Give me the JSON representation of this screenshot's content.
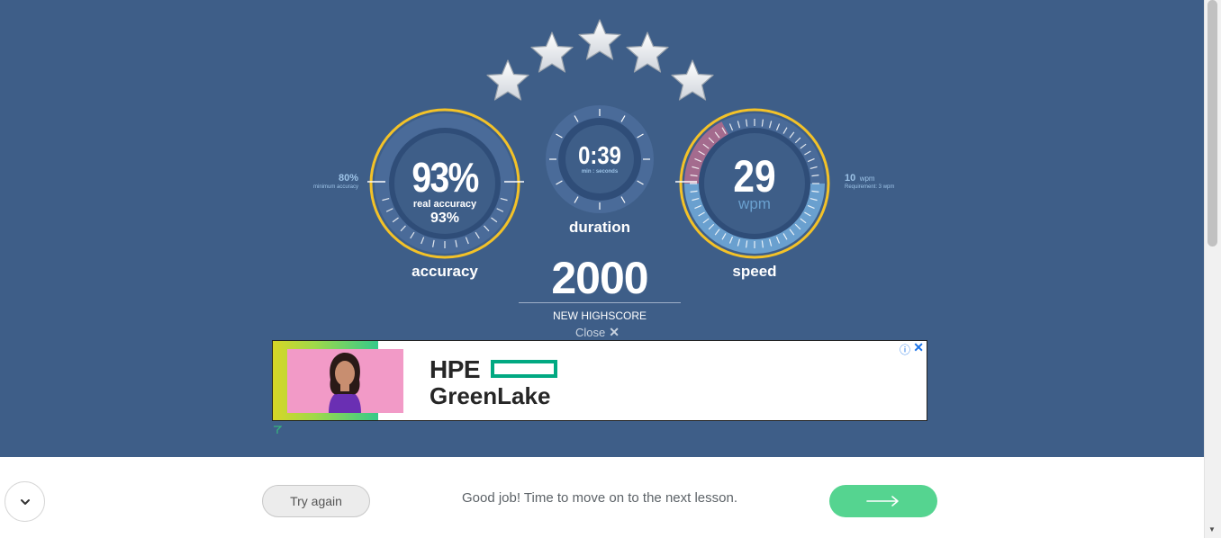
{
  "stars": {
    "count": 5,
    "filled": 5,
    "color": "#ffffff"
  },
  "accuracy": {
    "value": "93%",
    "real_label": "real accuracy",
    "real_value": "93%",
    "caption": "accuracy",
    "minimum_value": "80%",
    "minimum_label": "minimum accuracy",
    "level": 0.93
  },
  "duration": {
    "value": "0:39",
    "unit_label": "min : seconds",
    "caption": "duration"
  },
  "speed": {
    "value": "29",
    "unit": "wpm",
    "caption": "speed",
    "requirement_value": "10",
    "requirement_unit": "wpm",
    "requirement_label": "Requirement: 3 wpm"
  },
  "score": {
    "value": "2000",
    "caption": "NEW HIGHSCORE"
  },
  "close": {
    "label": "Close",
    "icon": "close-icon"
  },
  "ad": {
    "brand_line1": "HPE",
    "brand_line2": "GreenLake",
    "info_icon": "info-icon",
    "close_icon": "close-icon"
  },
  "footer": {
    "try_again": "Try again",
    "message": "Good job! Time to move on to the next lesson.",
    "next_icon": "arrow-right-icon",
    "toggle_icon": "chevron-down-icon"
  },
  "colors": {
    "background": "#3e5e88",
    "gauge_ring": "#f3c228",
    "gauge_dark": "#2f4d78",
    "gauge_mid": "#4a6b99",
    "speed_fill": "#6aa0cf",
    "speed_low": "#a46b8e",
    "next_button": "#55d490"
  }
}
